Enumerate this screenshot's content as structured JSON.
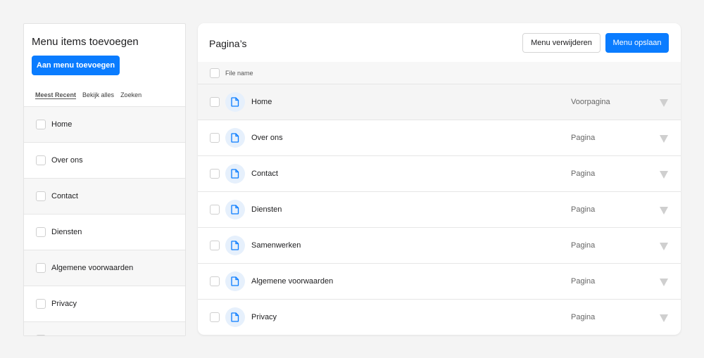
{
  "left_panel": {
    "title": "Menu items toevoegen",
    "add_button": "Aan menu toevoegen",
    "tabs": [
      {
        "label": "Meest Recent",
        "active": true
      },
      {
        "label": "Bekijk alles",
        "active": false
      },
      {
        "label": "Zoeken",
        "active": false
      }
    ],
    "items": [
      {
        "label": "Home"
      },
      {
        "label": "Over ons"
      },
      {
        "label": "Contact"
      },
      {
        "label": "Diensten"
      },
      {
        "label": "Algemene voorwaarden"
      },
      {
        "label": "Privacy"
      }
    ]
  },
  "right_panel": {
    "title": "Pagina’s",
    "delete_button": "Menu verwijderen",
    "save_button": "Menu opslaan",
    "column_header": "File name",
    "rows": [
      {
        "name": "Home",
        "type": "Voorpagina",
        "icon": "file-icon"
      },
      {
        "name": "Over ons",
        "type": "Pagina",
        "icon": "file-icon"
      },
      {
        "name": "Contact",
        "type": "Pagina",
        "icon": "file-icon"
      },
      {
        "name": "Diensten",
        "type": "Pagina",
        "icon": "file-icon"
      },
      {
        "name": "Samenwerken",
        "type": "Pagina",
        "icon": "file-icon"
      },
      {
        "name": "Algemene voorwaarden",
        "type": "Pagina",
        "icon": "file-icon"
      },
      {
        "name": "Privacy",
        "type": "Pagina",
        "icon": "file-icon"
      }
    ]
  },
  "colors": {
    "accent": "#0a7cff",
    "background": "#f4f4f4",
    "icon_bg": "#e6f0fc"
  }
}
